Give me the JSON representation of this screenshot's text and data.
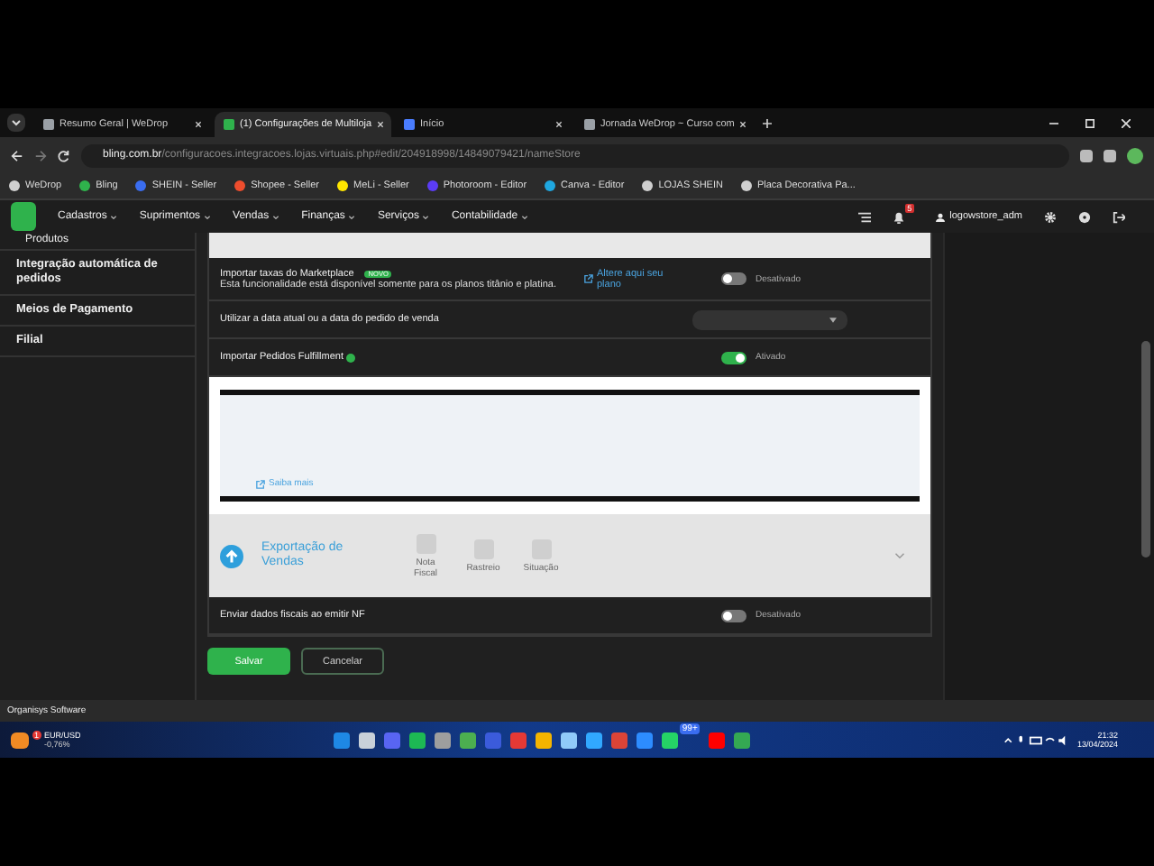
{
  "browser": {
    "tabs": [
      {
        "title": "Resumo Geral | WeDrop",
        "selected": false,
        "color": "#9aa0a6"
      },
      {
        "title": "(1) Configurações de Multiloja",
        "selected": true,
        "color": "#2fb24c"
      },
      {
        "title": "Início",
        "selected": false,
        "color": "#4a7dff"
      },
      {
        "title": "Jornada WeDrop ~ Curso com",
        "selected": false,
        "color": "#9aa0a6"
      }
    ],
    "url_host": "bling.com.br",
    "url_path": "/configuracoes.integracoes.lojas.virtuais.php#edit/204918998/14849079421/nameStore",
    "bookmarks": [
      {
        "label": "WeDrop",
        "color": "#cfcfcf"
      },
      {
        "label": "Bling",
        "color": "#2fb24c"
      },
      {
        "label": "SHEIN - Seller",
        "color": "#3a6df0"
      },
      {
        "label": "Shopee - Seller",
        "color": "#ee4d2d"
      },
      {
        "label": "MeLi - Seller",
        "color": "#ffe600"
      },
      {
        "label": "Photoroom - Editor",
        "color": "#5b3cf5"
      },
      {
        "label": "Canva - Editor",
        "color": "#1fa7e0"
      },
      {
        "label": "LOJAS SHEIN",
        "color": "#cfcfcf"
      },
      {
        "label": "Placa Decorativa Pa...",
        "color": "#cfcfcf"
      }
    ]
  },
  "app": {
    "menu": [
      "Cadastros",
      "Suprimentos",
      "Vendas",
      "Finanças",
      "Serviços",
      "Contabilidade"
    ],
    "notifications": "5",
    "user": "logowstore_adm",
    "sidebar": [
      {
        "label": "Produtos",
        "kind": "sub"
      },
      {
        "label": "Integração automática de pedidos",
        "kind": "item"
      },
      {
        "label": "Meios de Pagamento",
        "kind": "item"
      },
      {
        "label": "Filial",
        "kind": "item"
      }
    ],
    "marketplace": {
      "title": "Importar taxas do Marketplace",
      "badge": "NOVO",
      "description": "Esta funcionalidade está disponível somente para os planos titânio e platina.",
      "link": "Altere aqui seu plano",
      "toggle": {
        "on": false,
        "label": "Desativado"
      }
    },
    "date_row": {
      "label": "Utilizar a data atual ou a data do pedido de venda"
    },
    "fulfillment": {
      "label": "Importar Pedidos Fulfillment",
      "toggle": {
        "on": true,
        "label": "Ativado"
      }
    },
    "info_link": "Saiba mais",
    "export": {
      "title": "Exportação de Vendas",
      "steps": [
        "Nota Fiscal",
        "Rastreio",
        "Situação"
      ]
    },
    "fiscal": {
      "label": "Enviar dados fiscais ao emitir NF",
      "toggle": {
        "on": false,
        "label": "Desativado"
      }
    },
    "buttons": {
      "save": "Salvar",
      "cancel": "Cancelar"
    }
  },
  "status_bar": "Organisys Software",
  "taskbar": {
    "ticker": "EUR/USD",
    "change": "-0,76%",
    "badge": "1",
    "chat_badge": "99+",
    "time": "21:32",
    "date": "13/04/2024"
  }
}
